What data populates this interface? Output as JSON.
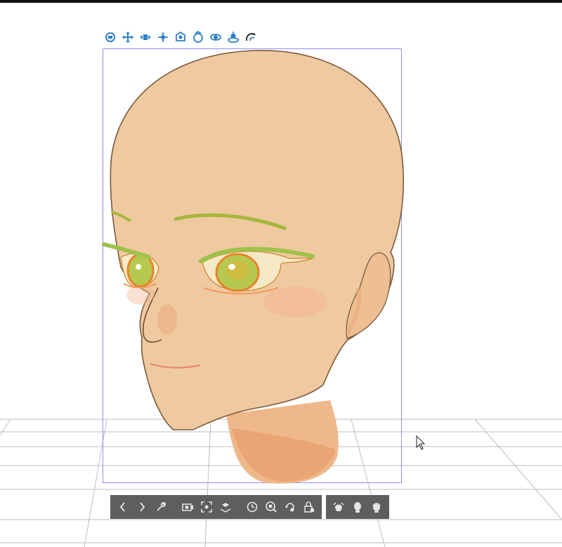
{
  "app": {
    "name": ""
  },
  "colors": {
    "gizmo_blue": "#2f7fc8",
    "toolbar_bg": "#5e5e5e",
    "toolbar_icon": "#e6e6e6",
    "bbox_line": "#8e8ef0",
    "skin": "#efc9a0",
    "skin_shadow": "#e8a878",
    "outline": "#7a5a3a",
    "eye_green": "#9fc24a",
    "eye_orange": "#e8822a",
    "grid_line": "#bdbdbd"
  },
  "viewport": {
    "object": "3D head model",
    "grid_visible": true
  },
  "gizmo_tools": [
    {
      "id": "rotate-camera",
      "icon": "camera-rotate-icon"
    },
    {
      "id": "pan-camera",
      "icon": "camera-pan-icon"
    },
    {
      "id": "dolly-camera",
      "icon": "camera-dolly-icon"
    },
    {
      "id": "move-object",
      "icon": "object-move-icon"
    },
    {
      "id": "move-2d",
      "icon": "object-move-2d-icon"
    },
    {
      "id": "rotate-object",
      "icon": "object-rotate-icon"
    },
    {
      "id": "rotate-xy",
      "icon": "object-rotate-xy-icon"
    },
    {
      "id": "rotate-ground",
      "icon": "object-rotate-ground-icon"
    },
    {
      "id": "snap-ground",
      "icon": "snap-to-ground-icon"
    }
  ],
  "toolbar": {
    "group1": [
      {
        "id": "prev",
        "icon": "chevron-left-icon"
      },
      {
        "id": "next",
        "icon": "chevron-right-icon"
      },
      {
        "id": "settings",
        "icon": "wrench-icon"
      },
      {
        "id": "camera-reset",
        "icon": "camera-reset-icon"
      },
      {
        "id": "fit",
        "icon": "fit-frame-icon"
      },
      {
        "id": "ground",
        "icon": "ground-icon"
      },
      {
        "id": "timer",
        "icon": "clock-icon"
      },
      {
        "id": "reset-pose",
        "icon": "reset-pose-icon"
      },
      {
        "id": "rotate-reset",
        "icon": "rotate-reset-icon"
      },
      {
        "id": "lock",
        "icon": "lock-icon"
      }
    ],
    "group2": [
      {
        "id": "head-preset-1",
        "icon": "head-preset-icon"
      },
      {
        "id": "head-preset-2",
        "icon": "head-front-icon"
      },
      {
        "id": "head-preset-3",
        "icon": "head-hair-icon"
      }
    ]
  }
}
